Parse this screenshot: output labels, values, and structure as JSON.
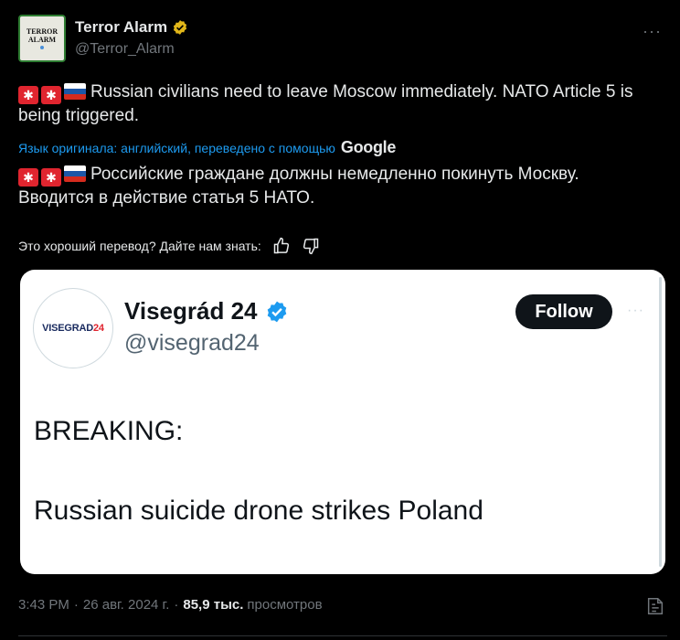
{
  "author": {
    "display_name": "Terror Alarm",
    "handle": "@Terror_Alarm",
    "avatar_line1": "TERROR",
    "avatar_line2": "ALARM"
  },
  "more_label": "···",
  "emoji_prefix": "🚨🚨🇷🇺",
  "post_original": "Russian civilians need to leave Moscow immediately. NATO Article 5 is being triggered.",
  "translation_note": "Язык оригинала: английский, переведено с помощью",
  "translation_provider": "Google",
  "post_translated": "Российские граждане должны немедленно покинуть Москву. Вводится в действие статья 5 НАТО.",
  "feedback_prompt": "Это хороший перевод? Дайте нам знать:",
  "quoted": {
    "avatar_logo_main": "VISEGRAD",
    "avatar_logo_num": "24",
    "display_name": "Visegrád 24",
    "handle": "@visegrad24",
    "follow_label": "Follow",
    "more_label": "···",
    "line1": "BREAKING:",
    "line2": "Russian suicide drone strikes Poland"
  },
  "meta": {
    "time": "3:43 PM",
    "sep": "·",
    "date": "26 авг. 2024 г.",
    "views_count": "85,9 тыс.",
    "views_label": "просмотров"
  },
  "colors": {
    "background": "#000000",
    "link": "#1d9bf0",
    "muted": "#71767b",
    "gold_badge": "#e2b719",
    "blue_badge": "#1d9bf0"
  }
}
